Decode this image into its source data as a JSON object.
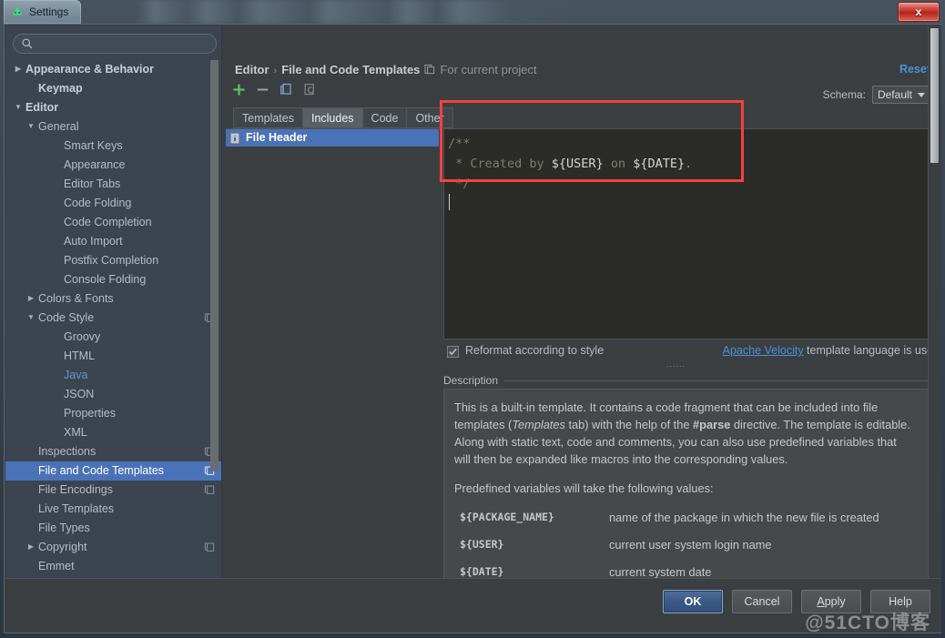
{
  "window": {
    "title": "Settings",
    "app_icon": "android-studio-icon",
    "close_label": "x"
  },
  "sidebar": {
    "search": {
      "value": "",
      "placeholder": "",
      "icon": "search-icon"
    },
    "items": [
      {
        "label": "Appearance & Behavior",
        "indent": 0,
        "twisty": "collapsed",
        "bold": true,
        "selected": false,
        "copy": false,
        "accent": false
      },
      {
        "label": "Keymap",
        "indent": 1,
        "twisty": "none",
        "bold": true,
        "selected": false,
        "copy": false,
        "accent": false
      },
      {
        "label": "Editor",
        "indent": 0,
        "twisty": "expanded",
        "bold": true,
        "selected": false,
        "copy": false,
        "accent": false
      },
      {
        "label": "General",
        "indent": 1,
        "twisty": "expanded",
        "bold": false,
        "selected": false,
        "copy": false,
        "accent": false
      },
      {
        "label": "Smart Keys",
        "indent": 3,
        "twisty": "none",
        "bold": false,
        "selected": false,
        "copy": false,
        "accent": false
      },
      {
        "label": "Appearance",
        "indent": 3,
        "twisty": "none",
        "bold": false,
        "selected": false,
        "copy": false,
        "accent": false
      },
      {
        "label": "Editor Tabs",
        "indent": 3,
        "twisty": "none",
        "bold": false,
        "selected": false,
        "copy": false,
        "accent": false
      },
      {
        "label": "Code Folding",
        "indent": 3,
        "twisty": "none",
        "bold": false,
        "selected": false,
        "copy": false,
        "accent": false
      },
      {
        "label": "Code Completion",
        "indent": 3,
        "twisty": "none",
        "bold": false,
        "selected": false,
        "copy": false,
        "accent": false
      },
      {
        "label": "Auto Import",
        "indent": 3,
        "twisty": "none",
        "bold": false,
        "selected": false,
        "copy": false,
        "accent": false
      },
      {
        "label": "Postfix Completion",
        "indent": 3,
        "twisty": "none",
        "bold": false,
        "selected": false,
        "copy": false,
        "accent": false
      },
      {
        "label": "Console Folding",
        "indent": 3,
        "twisty": "none",
        "bold": false,
        "selected": false,
        "copy": false,
        "accent": false
      },
      {
        "label": "Colors & Fonts",
        "indent": 1,
        "twisty": "collapsed",
        "bold": false,
        "selected": false,
        "copy": false,
        "accent": false
      },
      {
        "label": "Code Style",
        "indent": 1,
        "twisty": "expanded",
        "bold": false,
        "selected": false,
        "copy": true,
        "accent": false
      },
      {
        "label": "Groovy",
        "indent": 3,
        "twisty": "none",
        "bold": false,
        "selected": false,
        "copy": false,
        "accent": false
      },
      {
        "label": "HTML",
        "indent": 3,
        "twisty": "none",
        "bold": false,
        "selected": false,
        "copy": false,
        "accent": false
      },
      {
        "label": "Java",
        "indent": 3,
        "twisty": "none",
        "bold": false,
        "selected": false,
        "copy": false,
        "accent": true
      },
      {
        "label": "JSON",
        "indent": 3,
        "twisty": "none",
        "bold": false,
        "selected": false,
        "copy": false,
        "accent": false
      },
      {
        "label": "Properties",
        "indent": 3,
        "twisty": "none",
        "bold": false,
        "selected": false,
        "copy": false,
        "accent": false
      },
      {
        "label": "XML",
        "indent": 3,
        "twisty": "none",
        "bold": false,
        "selected": false,
        "copy": false,
        "accent": false
      },
      {
        "label": "Inspections",
        "indent": 1,
        "twisty": "none",
        "bold": false,
        "selected": false,
        "copy": true,
        "accent": false
      },
      {
        "label": "File and Code Templates",
        "indent": 1,
        "twisty": "none",
        "bold": false,
        "selected": true,
        "copy": true,
        "accent": false
      },
      {
        "label": "File Encodings",
        "indent": 1,
        "twisty": "none",
        "bold": false,
        "selected": false,
        "copy": true,
        "accent": false
      },
      {
        "label": "Live Templates",
        "indent": 1,
        "twisty": "none",
        "bold": false,
        "selected": false,
        "copy": false,
        "accent": false
      },
      {
        "label": "File Types",
        "indent": 1,
        "twisty": "none",
        "bold": false,
        "selected": false,
        "copy": false,
        "accent": false
      },
      {
        "label": "Copyright",
        "indent": 1,
        "twisty": "collapsed",
        "bold": false,
        "selected": false,
        "copy": true,
        "accent": false
      },
      {
        "label": "Emmet",
        "indent": 1,
        "twisty": "none",
        "bold": false,
        "selected": false,
        "copy": false,
        "accent": false
      }
    ]
  },
  "header": {
    "breadcrumb": [
      "Editor",
      "File and Code Templates"
    ],
    "separator": "›",
    "scope_icon": "project-scope-icon",
    "scope_label": "For current project",
    "reset_label": "Reset",
    "schema_label": "Schema:",
    "schema_value": "Default"
  },
  "toolbar": {
    "icons": [
      {
        "name": "add-icon",
        "glyph": "+"
      },
      {
        "name": "remove-icon",
        "glyph": "−"
      },
      {
        "name": "copy-icon",
        "glyph": "copy"
      },
      {
        "name": "reset-template-icon",
        "glyph": "reset"
      }
    ]
  },
  "tabs": [
    {
      "label": "Templates",
      "active": false
    },
    {
      "label": "Includes",
      "active": true
    },
    {
      "label": "Code",
      "active": false
    },
    {
      "label": "Other",
      "active": false
    }
  ],
  "template_list": [
    {
      "label": "File Header",
      "icon": "file-icon",
      "selected": true
    }
  ],
  "editor": {
    "lines": [
      [
        {
          "t": "/**",
          "c": "c-comment"
        }
      ],
      [
        {
          "t": " * Created by ",
          "c": "c-comment"
        },
        {
          "t": "${USER}",
          "c": "c-var"
        },
        {
          "t": " on ",
          "c": "c-comment"
        },
        {
          "t": "${DATE}",
          "c": "c-var"
        },
        {
          "t": ".",
          "c": "c-punct"
        }
      ],
      [
        {
          "t": " */",
          "c": "c-comment"
        }
      ]
    ],
    "reformat_label": "Reformat according to style",
    "reformat_checked": true,
    "velocity_link": "Apache Velocity",
    "velocity_rest": " template language is used"
  },
  "description": {
    "legend": "Description",
    "paragraphs": [
      "This is a built-in template. It contains a code fragment that can be included into file templates (Templates tab) with the help of the #parse directive. The template is editable. Along with static text, code and comments, you can also use predefined variables that will then be expanded like macros into the corresponding values.",
      "Predefined variables will take the following values:"
    ],
    "p1_a": "This is a built-in template. It contains a code fragment that can be included into file templates (",
    "p1_it": "Templates",
    "p1_b": " tab) with the help of the ",
    "p1_bd": "#parse",
    "p1_c": " directive. The template is editable. Along with static text, code and comments, you can also use predefined variables that will then be expanded like macros into the corresponding values.",
    "p2": "Predefined variables will take the following values:",
    "variables": [
      {
        "name": "${PACKAGE_NAME}",
        "desc": "name of the package in which the new file is created"
      },
      {
        "name": "${USER}",
        "desc": "current user system login name"
      },
      {
        "name": "${DATE}",
        "desc": "current system date"
      }
    ]
  },
  "footer": {
    "buttons": [
      {
        "label": "OK",
        "primary": true,
        "mnemonic": ""
      },
      {
        "label": "Cancel",
        "primary": false,
        "mnemonic": ""
      },
      {
        "label": "Apply",
        "primary": false,
        "mnemonic": "A"
      },
      {
        "label": "Help",
        "primary": false,
        "mnemonic": ""
      }
    ]
  },
  "watermark": "@51CTO博客",
  "colors": {
    "selection": "#4a72b8",
    "link": "#4a90d9",
    "annotation": "#f4433c",
    "editor_bg": "#2b2b28",
    "dialog_bg": "#3c3f41",
    "sidebar_bg": "#3c4450"
  }
}
